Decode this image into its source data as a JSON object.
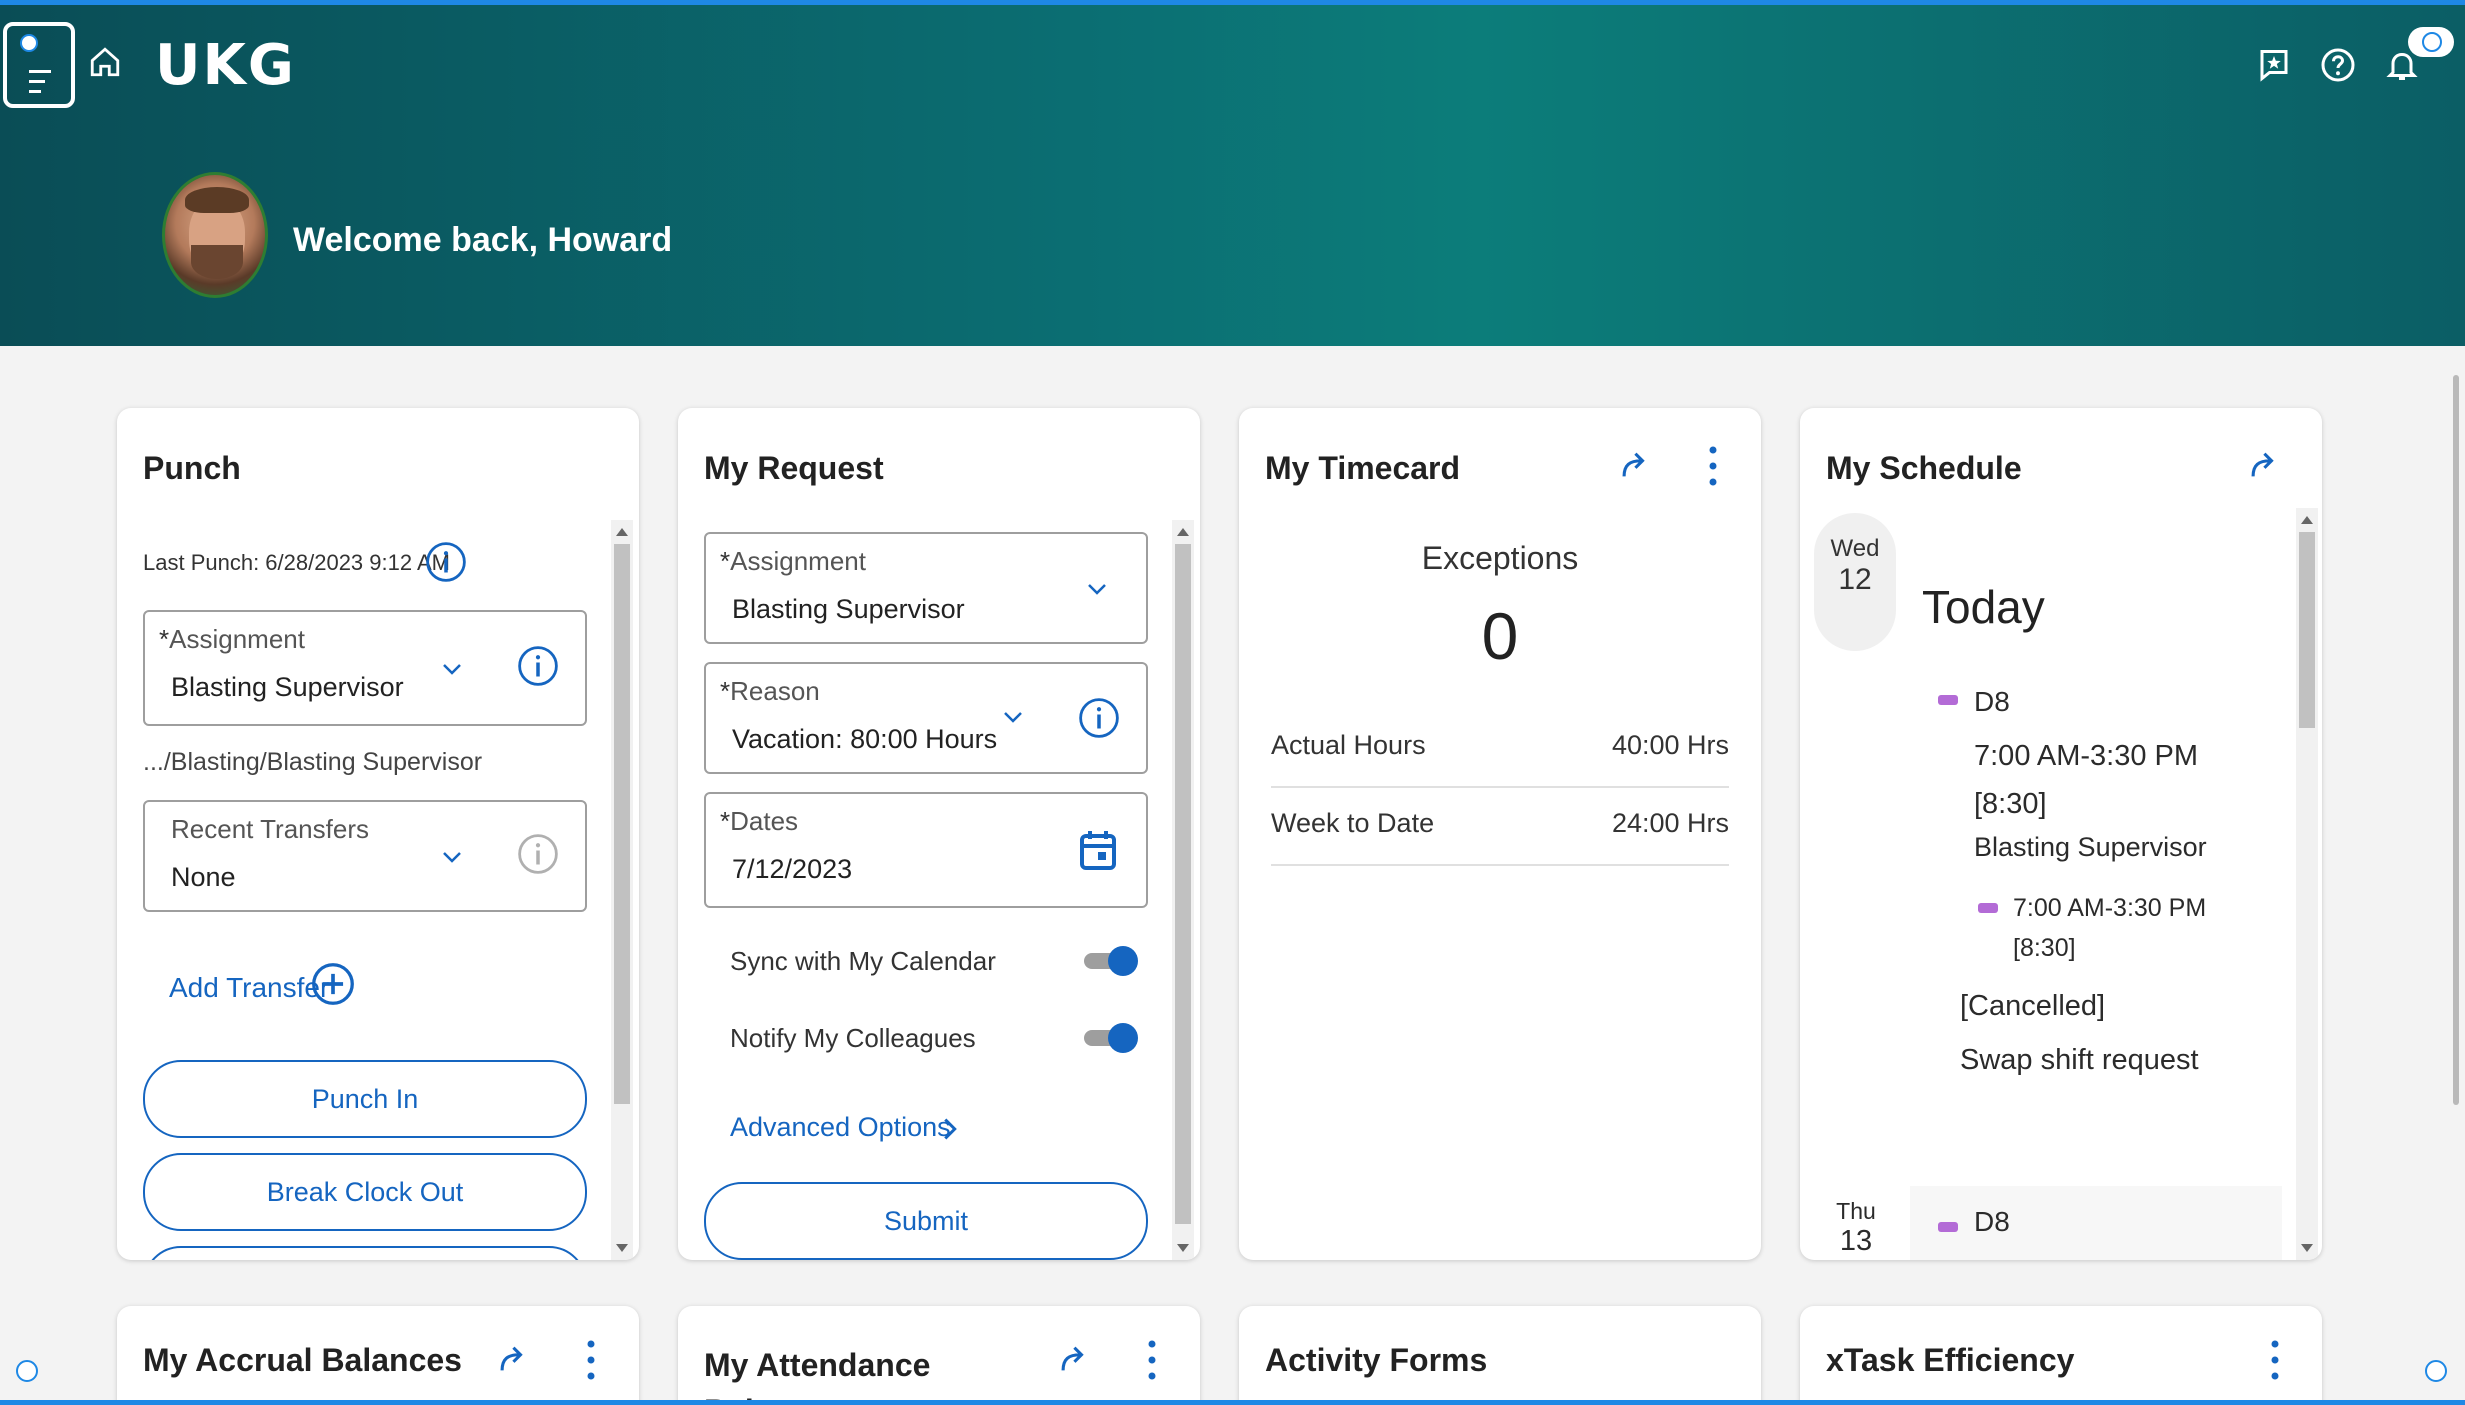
{
  "header": {
    "logo": "UKG",
    "welcome": "Welcome back, Howard",
    "colors": {
      "gradient_start": "#0a4d56",
      "gradient_mid": "#0c7d7a",
      "accent": "#1e88e5"
    }
  },
  "punch": {
    "title": "Punch",
    "last_punch": "Last Punch: 6/28/2023 9:12 AM",
    "assignment_label": "Assignment",
    "assignment_value": "Blasting Supervisor",
    "path": ".../Blasting/Blasting Supervisor",
    "transfers_label": "Recent Transfers",
    "transfers_value": "None",
    "add_transfer": "Add Transfer",
    "punch_in": "Punch In",
    "break_clock_out": "Break Clock Out"
  },
  "request": {
    "title": "My Request",
    "assignment_label": "Assignment",
    "assignment_value": "Blasting Supervisor",
    "reason_label": "Reason",
    "reason_value": "Vacation: 80:00 Hours",
    "dates_label": "Dates",
    "dates_value": "7/12/2023",
    "sync_label": "Sync with My Calendar",
    "notify_label": "Notify My Colleagues",
    "advanced": "Advanced Options",
    "submit": "Submit"
  },
  "timecard": {
    "title": "My Timecard",
    "exceptions_label": "Exceptions",
    "exceptions_value": "0",
    "rows": [
      {
        "label": "Actual Hours",
        "value": "40:00 Hrs"
      },
      {
        "label": "Week to Date",
        "value": "24:00 Hrs"
      }
    ]
  },
  "schedule": {
    "title": "My Schedule",
    "day1_name": "Wed",
    "day1_num": "12",
    "today": "Today",
    "shift_code": "D8",
    "shift_time": "7:00 AM-3:30 PM",
    "shift_duration": "[8:30]",
    "shift_job": "Blasting Supervisor",
    "sub_time": "7:00 AM-3:30 PM",
    "sub_duration": "[8:30]",
    "cancelled": "[Cancelled]",
    "swap": "Swap shift request",
    "day2_name": "Thu",
    "day2_num": "13",
    "day2_code": "D8"
  },
  "bottom_cards": {
    "accrual": "My Accrual Balances",
    "attendance": "My Attendance Balances",
    "activity": "Activity Forms",
    "xtask": "xTask Efficiency"
  }
}
